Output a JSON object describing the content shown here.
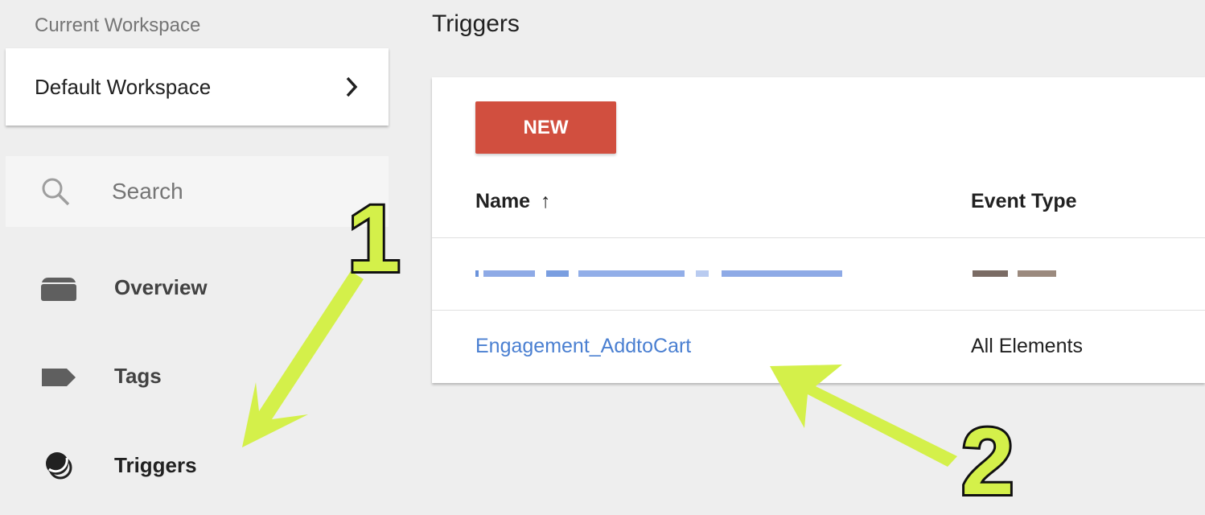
{
  "sidebar": {
    "workspace_label": "Current Workspace",
    "workspace_name": "Default Workspace",
    "search_placeholder": "Search",
    "nav": [
      {
        "label": "Overview",
        "icon": "folder-icon"
      },
      {
        "label": "Tags",
        "icon": "tag-icon"
      },
      {
        "label": "Triggers",
        "icon": "trigger-icon"
      }
    ]
  },
  "main": {
    "title": "Triggers",
    "new_button": "NEW",
    "columns": {
      "name": "Name",
      "sort_indicator": "↑",
      "event_type": "Event Type"
    },
    "rows": [
      {
        "name": "",
        "event_type": "",
        "redacted": true
      },
      {
        "name": "Engagement_AddtoCart",
        "event_type": "All Elements",
        "redacted": false
      }
    ]
  },
  "annotations": [
    {
      "label": "1",
      "color": "#d4f04a"
    },
    {
      "label": "2",
      "color": "#d4f04a"
    }
  ],
  "colors": {
    "accent_red": "#d14f3f",
    "link_blue": "#4a7fd1",
    "annotation_green": "#d4f04a"
  }
}
